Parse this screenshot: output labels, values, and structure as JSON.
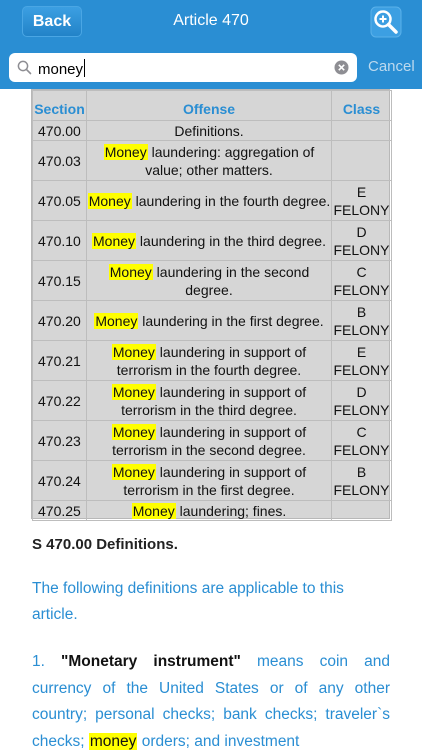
{
  "nav": {
    "back_label": "Back",
    "title": "Article 470",
    "zoom_icon": "zoom-in-icon"
  },
  "search": {
    "query": "money",
    "cancel_label": "Cancel"
  },
  "table": {
    "headers": {
      "section": "Section",
      "offense": "Offense",
      "class": "Class"
    },
    "rows": [
      {
        "section": "470.00",
        "pre": "",
        "hl": "",
        "post": "Definitions.",
        "cls1": "",
        "cls2": ""
      },
      {
        "section": "470.03",
        "pre": "",
        "hl": "Money",
        "post": " laundering: aggregation of value; other matters.",
        "cls1": "",
        "cls2": ""
      },
      {
        "section": "470.05",
        "pre": "",
        "hl": "Money",
        "post": " laundering in the fourth degree.",
        "cls1": "E",
        "cls2": "FELONY"
      },
      {
        "section": "470.10",
        "pre": "",
        "hl": "Money",
        "post": " laundering in the third degree.",
        "cls1": "D",
        "cls2": "FELONY"
      },
      {
        "section": "470.15",
        "pre": "",
        "hl": "Money",
        "post": " laundering in the second degree.",
        "cls1": "C",
        "cls2": "FELONY"
      },
      {
        "section": "470.20",
        "pre": "",
        "hl": "Money",
        "post": " laundering in the first degree.",
        "cls1": "B",
        "cls2": "FELONY"
      },
      {
        "section": "470.21",
        "pre": "",
        "hl": "Money",
        "post": " laundering in support of terrorism in the fourth degree.",
        "cls1": "E",
        "cls2": "FELONY"
      },
      {
        "section": "470.22",
        "pre": "",
        "hl": "Money",
        "post": " laundering in support of terrorism in the third degree.",
        "cls1": "D",
        "cls2": "FELONY"
      },
      {
        "section": "470.23",
        "pre": "",
        "hl": "Money",
        "post": " laundering in support of terrorism in the second degree.",
        "cls1": "C",
        "cls2": "FELONY"
      },
      {
        "section": "470.24",
        "pre": "",
        "hl": "Money",
        "post": " laundering in support of terrorism in the first degree.",
        "cls1": "B",
        "cls2": "FELONY"
      },
      {
        "section": "470.25",
        "pre": "",
        "hl": "Money",
        "post": " laundering; fines.",
        "cls1": "",
        "cls2": ""
      }
    ]
  },
  "article": {
    "heading": "S 470.00 Definitions.",
    "intro": "The following definitions are applicable to this article.",
    "item1_number": "1.",
    "item1_term": "\"Monetary instrument\"",
    "item1_text_a": " means coin and currency of the United States or of any other country; personal checks; bank checks; traveler`s checks; ",
    "item1_hl": "money",
    "item1_text_b": " orders; and investment"
  },
  "colors": {
    "bar": "#2a8ed3",
    "highlight": "#ffff00",
    "link_text": "#2a8ed3",
    "table_bg": "#d6d6d6"
  }
}
